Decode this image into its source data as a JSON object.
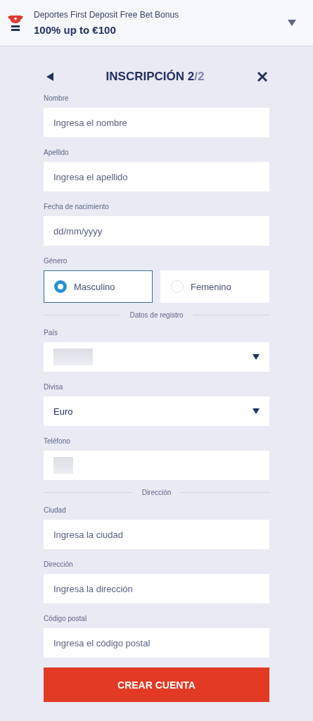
{
  "promo": {
    "title": "Deportes First Deposit Free Bet Bonus",
    "offer": "100% up to €100"
  },
  "header": {
    "title": "INSCRIPCIÓN 2",
    "step": "/2"
  },
  "form": [
    {
      "kind": "text",
      "label": "Nombre",
      "placeholder": "Ingresa el nombre"
    },
    {
      "kind": "text",
      "label": "Apellido",
      "placeholder": "Ingresa el apellido"
    },
    {
      "kind": "text",
      "label": "Fecha de nacimiento",
      "placeholder": "dd/mm/yyyy"
    },
    {
      "kind": "radio",
      "label": "Género",
      "options": [
        {
          "label": "Masculino",
          "selected": true
        },
        {
          "label": "Femenino",
          "selected": false
        }
      ]
    },
    {
      "kind": "divider",
      "label": "Datos de registro"
    },
    {
      "kind": "select",
      "label": "País",
      "redacted": true
    },
    {
      "kind": "select",
      "label": "Divisa",
      "value": "Euro"
    },
    {
      "kind": "text",
      "label": "Teléfono",
      "redacted": true
    },
    {
      "kind": "divider",
      "label": "Dirección"
    },
    {
      "kind": "text",
      "label": "Ciudad",
      "placeholder": "Ingresa la ciudad"
    },
    {
      "kind": "text",
      "label": "Dirección",
      "placeholder": "Ingresa la dirección"
    },
    {
      "kind": "text",
      "label": "Código postal",
      "placeholder": "Ingresa el código postal"
    }
  ],
  "submit": "CREAR CUENTA"
}
